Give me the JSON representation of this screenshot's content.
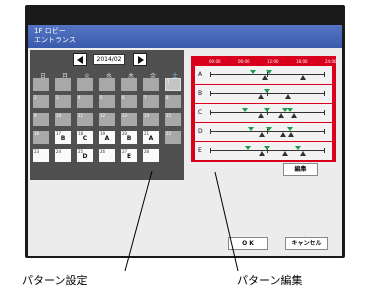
{
  "window": {
    "title_line1": "1F ロビー",
    "title_line2": "エントランス"
  },
  "calendar": {
    "month": "2014/02",
    "weekdays": [
      "日",
      "月",
      "火",
      "水",
      "木",
      "金",
      "土"
    ],
    "rows": [
      [
        {
          "d": "",
          "p": "",
          "s": "off"
        },
        {
          "d": "",
          "p": "",
          "s": "off"
        },
        {
          "d": "",
          "p": "",
          "s": "off"
        },
        {
          "d": "",
          "p": "",
          "s": "off"
        },
        {
          "d": "",
          "p": "",
          "s": "off"
        },
        {
          "d": "",
          "p": "",
          "s": "off"
        },
        {
          "d": "1",
          "p": "",
          "s": "dim"
        }
      ],
      [
        {
          "d": "2",
          "p": "",
          "s": "off"
        },
        {
          "d": "3",
          "p": "",
          "s": "off"
        },
        {
          "d": "4",
          "p": "",
          "s": "off"
        },
        {
          "d": "5",
          "p": "",
          "s": "off"
        },
        {
          "d": "6",
          "p": "",
          "s": "off"
        },
        {
          "d": "7",
          "p": "",
          "s": "off"
        },
        {
          "d": "8",
          "p": "",
          "s": "off"
        }
      ],
      [
        {
          "d": "9",
          "p": "",
          "s": "off"
        },
        {
          "d": "10",
          "p": "",
          "s": "off"
        },
        {
          "d": "11",
          "p": "",
          "s": "off"
        },
        {
          "d": "12",
          "p": "",
          "s": "off"
        },
        {
          "d": "13",
          "p": "",
          "s": "off"
        },
        {
          "d": "14",
          "p": "",
          "s": "off"
        },
        {
          "d": "15",
          "p": "",
          "s": "off"
        }
      ],
      [
        {
          "d": "16",
          "p": "",
          "s": "off"
        },
        {
          "d": "17",
          "p": "B",
          "s": "on"
        },
        {
          "d": "18",
          "p": "C",
          "s": "on"
        },
        {
          "d": "19",
          "p": "A",
          "s": "on"
        },
        {
          "d": "20",
          "p": "B",
          "s": "on"
        },
        {
          "d": "21",
          "p": "A",
          "s": "on"
        },
        {
          "d": "22",
          "p": "",
          "s": "off"
        }
      ],
      [
        {
          "d": "23",
          "p": "",
          "s": "on"
        },
        {
          "d": "24",
          "p": "",
          "s": "on"
        },
        {
          "d": "25",
          "p": "D",
          "s": "on"
        },
        {
          "d": "26",
          "p": "",
          "s": "on"
        },
        {
          "d": "27",
          "p": "E",
          "s": "on"
        },
        {
          "d": "28",
          "p": "",
          "s": "on"
        },
        {
          "d": "",
          "p": "",
          "s": "none"
        }
      ]
    ]
  },
  "pattern_editor": {
    "hours": [
      "00:00",
      "06:00",
      "12:00",
      "18:00",
      "24:00"
    ],
    "patterns": [
      {
        "label": "A",
        "on": [
          0.38,
          0.52
        ],
        "off": [
          0.48,
          0.82
        ]
      },
      {
        "label": "B",
        "on": [
          0.5
        ],
        "off": [
          0.45,
          0.68
        ]
      },
      {
        "label": "C",
        "on": [
          0.31,
          0.5,
          0.66,
          0.7
        ],
        "off": [
          0.45,
          0.62,
          0.74
        ]
      },
      {
        "label": "D",
        "on": [
          0.36,
          0.52,
          0.7
        ],
        "off": [
          0.46,
          0.64,
          0.71
        ]
      },
      {
        "label": "E",
        "on": [
          0.33,
          0.5,
          0.77
        ],
        "off": [
          0.46,
          0.66,
          0.82
        ]
      }
    ],
    "edit_label": "編集"
  },
  "footer": {
    "ok_label": "O K",
    "cancel_label": "キャンセル"
  },
  "callouts": {
    "left": "パターン設定",
    "right": "パターン編集"
  },
  "colors": {
    "pattern_border": "#d8001c",
    "on_marker": "#1a9a4a",
    "off_marker": "#333333"
  }
}
